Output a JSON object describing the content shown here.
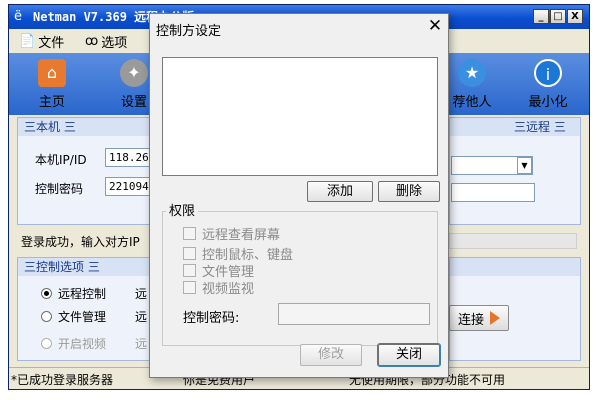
{
  "app": {
    "title": "Netman V7.369 远程办公版",
    "buttons": {
      "minimize": "_",
      "maximize": "□",
      "close": "X"
    }
  },
  "menu": [
    {
      "label": "文件",
      "icon": "file-icon"
    },
    {
      "label": "选项",
      "icon": "glasses-icon"
    }
  ],
  "toolbar": {
    "home": "主页",
    "settings": "设置",
    "recommend": "荐他人",
    "minimize": "最小化"
  },
  "local_group": {
    "header": "三本机 三",
    "ip_label": "本机IP/ID",
    "ip_value": "118.26.",
    "pw_label": "控制密码",
    "pw_value": "221094"
  },
  "remote_group": {
    "header": "三远程 三"
  },
  "login_status": "登录成功，输入对方IP",
  "control_group": {
    "header": "三控制选项 三",
    "options": [
      "远程控制",
      "文件管理",
      "开启视频"
    ],
    "col2": [
      "远",
      "远",
      "远"
    ],
    "connect": "连接"
  },
  "status_bar": {
    "left": "*已成功登录服务器",
    "mid": "你是免费用户",
    "right": "无使用期限，部分功能不可用"
  },
  "dialog": {
    "title": "控制方设定",
    "close": "✕",
    "add": "添加",
    "delete": "删除",
    "permissions_label": "权限",
    "permissions": [
      "远程查看屏幕",
      "控制鼠标、键盘",
      "文件管理",
      "视频监视"
    ],
    "password_label": "控制密码:",
    "modify": "修改",
    "close_button": "关闭"
  }
}
